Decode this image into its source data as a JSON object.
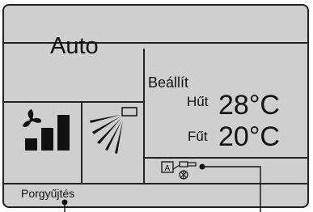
{
  "display": {
    "mode": "Auto",
    "setting_label": "Beállít",
    "cool_label": "Hűt",
    "cool_temp": "28°C",
    "heat_label": "Fűt",
    "heat_temp": "20°C",
    "status_text": "Porgyűjtés"
  },
  "icons": {
    "fan": "fan-icon",
    "fan_speed": "fan-speed-bars-icon",
    "airflow": "airflow-direction-icon",
    "auto_filter": "auto-filter-icon"
  },
  "colors": {
    "lcd_background": "#cfcfcf",
    "segment": "#111111"
  }
}
